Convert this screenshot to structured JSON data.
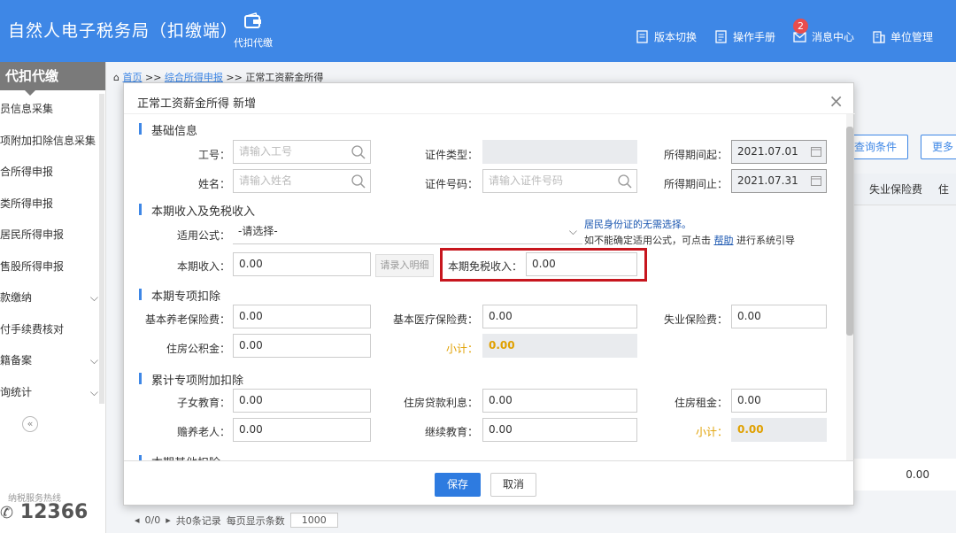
{
  "header": {
    "app_title": "自然人电子税务局（扣缴端）",
    "module_label": "代扣代缴",
    "links": {
      "version_switch": "版本切换",
      "manual": "操作手册",
      "messages": "消息中心",
      "unit_management": "单位管理"
    },
    "message_count": "2"
  },
  "sidebar": {
    "title": "代扣代缴",
    "items": [
      {
        "label": "员信息采集"
      },
      {
        "label": "项附加扣除信息采集"
      },
      {
        "label": "合所得申报"
      },
      {
        "label": "类所得申报"
      },
      {
        "label": "居民所得申报"
      },
      {
        "label": "售股所得申报"
      },
      {
        "label": "款缴纳"
      },
      {
        "label": "付手续费核对"
      },
      {
        "label": "籍备案"
      },
      {
        "label": "询统计"
      }
    ],
    "collapse_symbol": "«",
    "hotline_label": "纳税服务热线",
    "hotline_number": "12366"
  },
  "breadcrumb": {
    "home": "首页",
    "sep": ">>",
    "level2": "综合所得申报",
    "current": "正常工资薪金所得"
  },
  "background": {
    "query_btn": "查询条件",
    "more_btn": "更多",
    "col_header": "失业保险费",
    "col_header_next": "住",
    "row_value": "0.00",
    "pager": {
      "page": "0/0",
      "total": "共0条记录",
      "per_page_label": "每页显示条数",
      "per_page": "1000"
    }
  },
  "modal": {
    "title": "正常工资薪金所得 新增",
    "close_symbol": "×",
    "sections": {
      "basic": "基础信息",
      "income": "本期收入及免税收入",
      "special": "本期专项扣除",
      "cumulative": "累计专项附加扣除",
      "other": "本期其他扣除"
    },
    "basic": {
      "emp_id_label": "工号：",
      "emp_id_placeholder": "请输入工号",
      "name_label": "姓名：",
      "name_placeholder": "请输入姓名",
      "id_type_label": "证件类型：",
      "id_no_label": "证件号码：",
      "id_no_placeholder": "请输入证件号码",
      "period_start_label": "所得期间起：",
      "period_start": "2021.07.01",
      "period_end_label": "所得期间止：",
      "period_end": "2021.07.31"
    },
    "income": {
      "formula_label": "适用公式：",
      "formula_value": "-请选择-",
      "hint_line1": "居民身份证的无需选择。",
      "hint_line2_pre": "如不能确定适用公式，可点击",
      "hint_link": "帮助",
      "hint_line2_post": "进行系统引导",
      "income_label": "本期收入：",
      "income_value": "0.00",
      "detail_btn": "请录入明细",
      "exempt_label": "本期免税收入：",
      "exempt_value": "0.00"
    },
    "special": {
      "pension_label": "基本养老保险费：",
      "pension_value": "0.00",
      "medical_label": "基本医疗保险费：",
      "medical_value": "0.00",
      "unemployment_label": "失业保险费：",
      "unemployment_value": "0.00",
      "housing_fund_label": "住房公积金：",
      "housing_fund_value": "0.00",
      "subtotal_label": "小计：",
      "subtotal_value": "0.00"
    },
    "cumulative": {
      "children_label": "子女教育：",
      "children_value": "0.00",
      "loan_label": "住房贷款利息：",
      "loan_value": "0.00",
      "rent_label": "住房租金：",
      "rent_value": "0.00",
      "elderly_label": "赡养老人：",
      "elderly_value": "0.00",
      "continuing_label": "继续教育：",
      "continuing_value": "0.00",
      "subtotal_label": "小计：",
      "subtotal_value": "0.00"
    },
    "footer": {
      "save": "保存",
      "cancel": "取消"
    }
  },
  "colors": {
    "primary": "#3e87e6",
    "highlight_border": "#c7161e",
    "subtotal": "#e0a000"
  }
}
